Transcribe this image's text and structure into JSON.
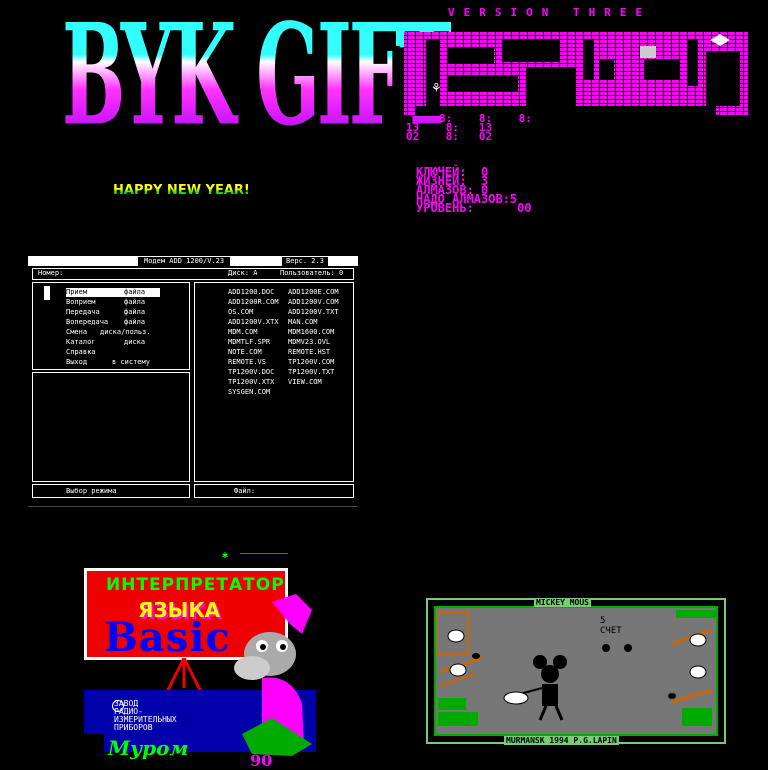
{
  "panel1": {
    "logo": "BYK GIFT",
    "greeting": "HAPPY NEW YEAR!"
  },
  "panel2": {
    "version": "VERSION THREE",
    "hud_lines": [
      "     8:    8:    8:",
      "13    8:   13",
      "02    8:   02"
    ],
    "stats": [
      {
        "label": "КЛЮЧЕЙ:",
        "value": "0"
      },
      {
        "label": "ЖИЗНЕЙ:",
        "value": "3"
      },
      {
        "label": "АЛМАЗОВ:",
        "value": "0"
      },
      {
        "label": "НАДО АЛМАЗОВ:",
        "value": "5"
      },
      {
        "label": "УРОВЕНЬ:",
        "value": "00"
      }
    ]
  },
  "panel3": {
    "title": "Модем  ADD 1200/V.23",
    "version": "Верс. 2.3",
    "number_label": "Номер:",
    "disk_label": "Диск: A",
    "user_label": "Пользователь: 0",
    "menu": [
      {
        "verb": "Прием",
        "obj": "файла"
      },
      {
        "verb": "Воприем",
        "obj": "файла"
      },
      {
        "verb": "Передача",
        "obj": "файла"
      },
      {
        "verb": "Вопередача",
        "obj": "файла"
      },
      {
        "verb": "Смена",
        "obj": "диска/польз."
      },
      {
        "verb": "Каталог",
        "obj": "диска"
      },
      {
        "verb": "Справка",
        "obj": ""
      },
      {
        "verb": "Выход",
        "obj": "в  систему"
      }
    ],
    "files_col1": [
      "ADD1200.DOC",
      "ADD1200R.COM",
      "OS.COM",
      "ADD1200V.XTX",
      "MDM.COM",
      "MDMTLF.SPR",
      "NOTE.COM",
      "REMOTE.VS",
      "TP1200V.DOC",
      "TP1200V.XTX",
      "SYSGEN.COM"
    ],
    "files_col2": [
      "ADD1200E.COM",
      "ADD1200V.COM",
      "ADD1200V.TXT",
      "MAN.COM",
      "MDM1600.COM",
      "MDMV23.OVL",
      "REMOTE.HST",
      "TP1200V.COM",
      "TP1200V.TXT",
      "VIEW.COM"
    ],
    "mode_label": "Выбор режима",
    "file_label": "Файл:"
  },
  "panel4": {
    "line1": "ИНТЕРПРЕТАТОР",
    "line2": "ЯЗЫКА",
    "line3": "Basic",
    "maker": [
      "ЗАВОД",
      "РАДИО-",
      "ИЗМЕРИТЕЛЬНЫХ",
      "ПРИБОРОВ"
    ],
    "city": "Муром",
    "year": "90"
  },
  "panel5": {
    "title": "MICKEY MOUS",
    "score_value": "5",
    "score_label": "СЧЕТ",
    "footer": "MURMANSK 1994  P.G.LAPIN"
  }
}
